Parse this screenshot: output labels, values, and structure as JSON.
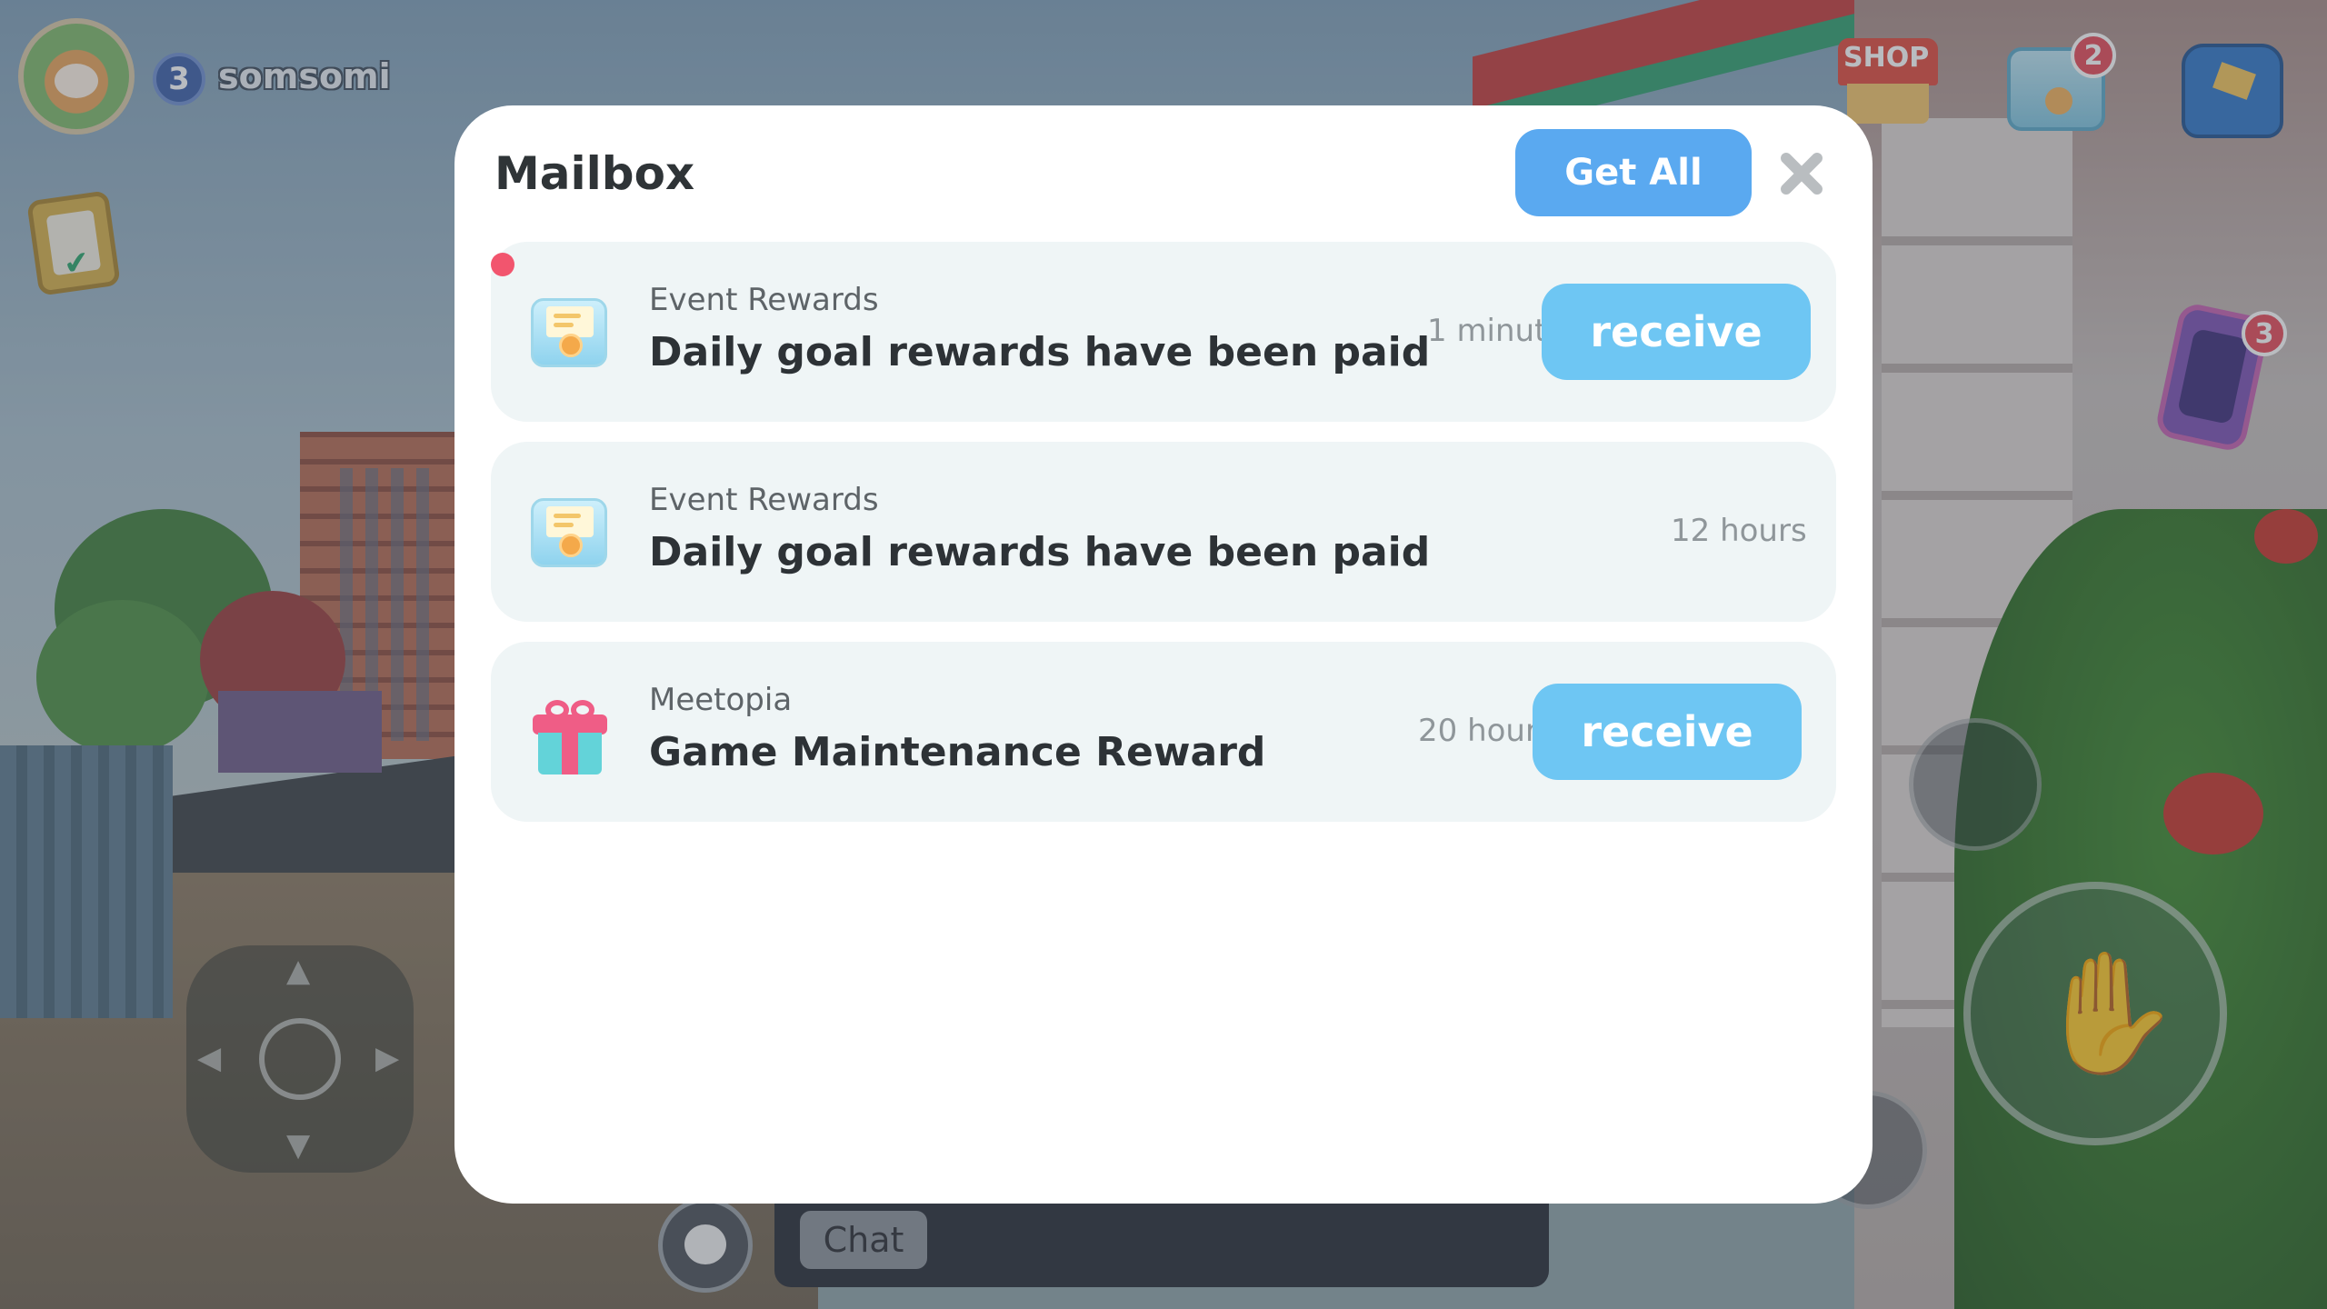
{
  "hud": {
    "level": "3",
    "username": "somsomi",
    "shop_label": "SHOP",
    "mail_badge": "2",
    "phone_badge": "3",
    "chat_label": "Chat"
  },
  "mailbox": {
    "title": "Mailbox",
    "get_all_label": "Get All",
    "items": [
      {
        "sender": "Event Rewards",
        "title": "Daily goal rewards have been paid",
        "time": "1 minute",
        "action": "receive",
        "icon": "envelope-icon",
        "unread": true
      },
      {
        "sender": "Event Rewards",
        "title": "Daily goal rewards have been paid",
        "time": "12 hours",
        "action": "",
        "icon": "envelope-icon",
        "unread": false
      },
      {
        "sender": "Meetopia",
        "title": "Game Maintenance Reward",
        "time": "20 hours",
        "action": "receive",
        "icon": "gift-icon",
        "unread": false
      }
    ]
  },
  "colors": {
    "accent_button": "#6ec6f3",
    "get_all_button": "#5aa9f0",
    "unread_dot": "#f2556e",
    "item_background": "#eff5f6"
  }
}
